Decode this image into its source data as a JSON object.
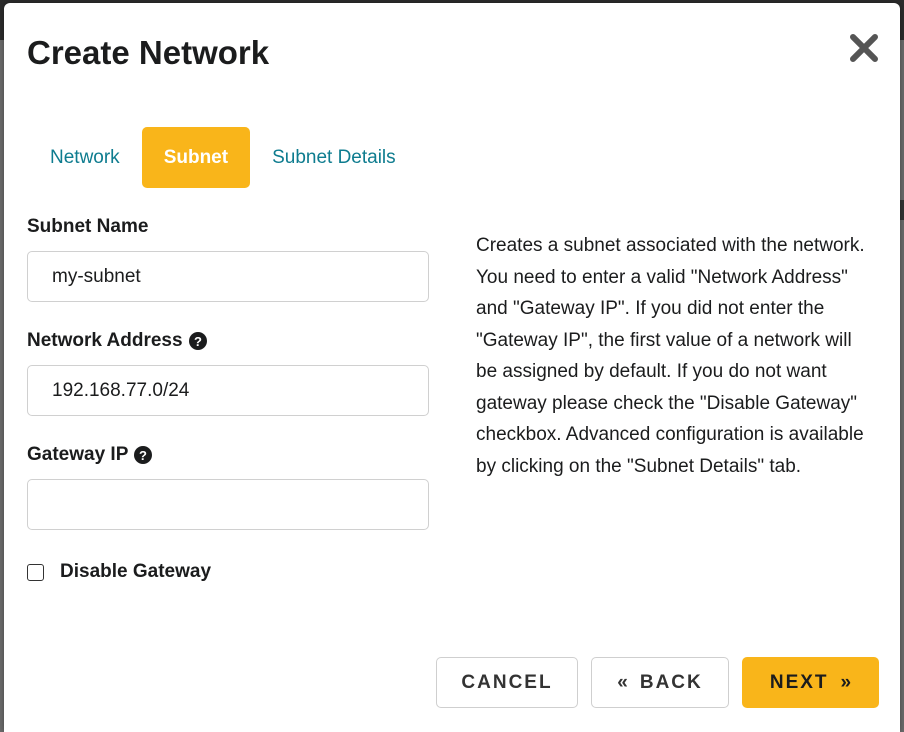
{
  "modal": {
    "title": "Create Network",
    "close_icon": "close-icon"
  },
  "tabs": [
    {
      "label": "Network",
      "active": false
    },
    {
      "label": "Subnet",
      "active": true
    },
    {
      "label": "Subnet Details",
      "active": false
    }
  ],
  "form": {
    "subnet_name": {
      "label": "Subnet Name",
      "value": "my-subnet"
    },
    "network_address": {
      "label": "Network Address",
      "value": "192.168.77.0/24",
      "help_icon": "question-circle-icon"
    },
    "gateway_ip": {
      "label": "Gateway IP",
      "value": "",
      "help_icon": "question-circle-icon"
    },
    "disable_gateway": {
      "label": "Disable Gateway",
      "checked": false
    }
  },
  "description": "Creates a subnet associated with the network. You need to enter a valid \"Network Address\" and \"Gateway IP\". If you did not enter the \"Gateway IP\", the first value of a network will be assigned by default. If you do not want gateway please check the \"Disable Gateway\" checkbox. Advanced configuration is available by clicking on the \"Subnet Details\" tab.",
  "buttons": {
    "cancel": "CANCEL",
    "back": "BACK",
    "back_arrow": "«",
    "next": "NEXT",
    "next_arrow": "»"
  },
  "colors": {
    "accent": "#f9b51a",
    "tab_link": "#0e7c8f",
    "text": "#1b1c1d"
  }
}
